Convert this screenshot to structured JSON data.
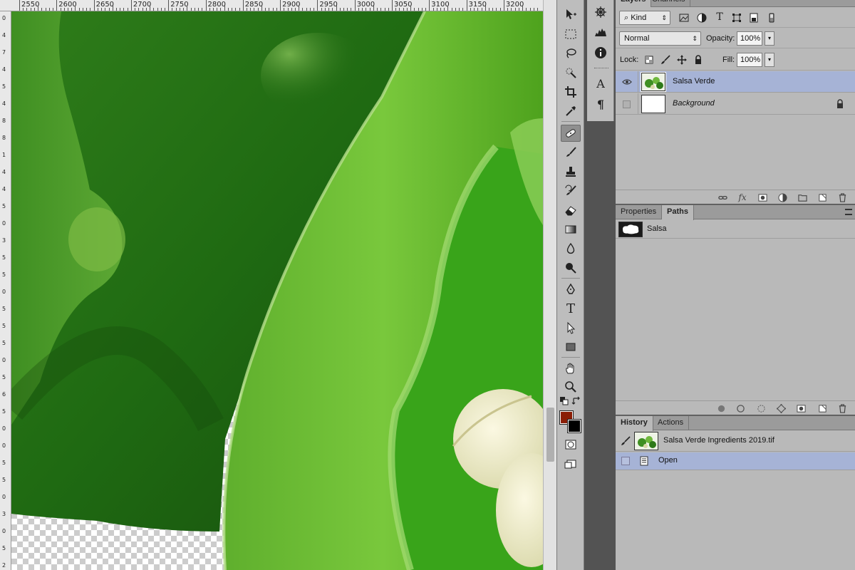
{
  "ruler": {
    "top_labels": [
      "2550",
      "2600",
      "2650",
      "2700",
      "2750",
      "2800",
      "2850",
      "2900",
      "2950",
      "3000",
      "3050",
      "3100",
      "3150",
      "3200"
    ],
    "left_labels": [
      "0",
      "4",
      "7",
      "4",
      "5",
      "4",
      "8",
      "8",
      "1",
      "4",
      "4",
      "5",
      "0",
      "3",
      "5",
      "5",
      "0",
      "5",
      "5",
      "5",
      "0",
      "5",
      "6",
      "5",
      "0",
      "0",
      "5",
      "5",
      "0",
      "3",
      "0",
      "5",
      "2"
    ]
  },
  "colors": {
    "foreground": "#8a1d05",
    "background": "#000000",
    "selection": "#a6b3d6",
    "panel": "#b9b9b9"
  },
  "tools": [
    {
      "name": "move-tool-icon"
    },
    {
      "name": "marquee-tool-icon"
    },
    {
      "name": "lasso-tool-icon"
    },
    {
      "name": "quick-selection-tool-icon"
    },
    {
      "name": "crop-tool-icon"
    },
    {
      "name": "eyedropper-tool-icon"
    },
    {
      "name": "spot-healing-tool-icon",
      "active": true
    },
    {
      "name": "brush-tool-icon"
    },
    {
      "name": "clone-stamp-tool-icon"
    },
    {
      "name": "history-brush-tool-icon"
    },
    {
      "name": "eraser-tool-icon"
    },
    {
      "name": "gradient-tool-icon"
    },
    {
      "name": "blur-tool-icon"
    },
    {
      "name": "dodge-tool-icon"
    },
    {
      "name": "pen-tool-icon"
    },
    {
      "name": "type-tool-icon"
    },
    {
      "name": "path-selection-tool-icon"
    },
    {
      "name": "rectangle-tool-icon"
    },
    {
      "name": "hand-tool-icon"
    },
    {
      "name": "zoom-tool-icon"
    }
  ],
  "tool_glyphs": {
    "type": "T"
  },
  "dock": {
    "character_glyph": "A",
    "paragraph_glyph": "¶"
  },
  "layers_panel": {
    "tabs": [
      "Layers",
      "Channels"
    ],
    "kind_label": "Kind",
    "blend_mode": "Normal",
    "opacity_label": "Opacity:",
    "opacity_value": "100%",
    "lock_label": "Lock:",
    "fill_label": "Fill:",
    "fill_value": "100%",
    "layers": [
      {
        "name": "Salsa Verde",
        "visible": true,
        "selected": true
      },
      {
        "name": "Background",
        "visible": false,
        "locked": true,
        "italic": true
      }
    ],
    "filter_glyph_type": "T",
    "footer_fx": "fx"
  },
  "properties_panel": {
    "tabs": [
      "Properties",
      "Paths"
    ],
    "active_tab": "Paths",
    "paths": [
      {
        "name": "Salsa"
      }
    ]
  },
  "history_panel": {
    "tabs": [
      "History",
      "Actions"
    ],
    "snapshot_name": "Salsa Verde Ingredients 2019.tif",
    "states": [
      {
        "name": "Open",
        "selected": true
      }
    ]
  }
}
